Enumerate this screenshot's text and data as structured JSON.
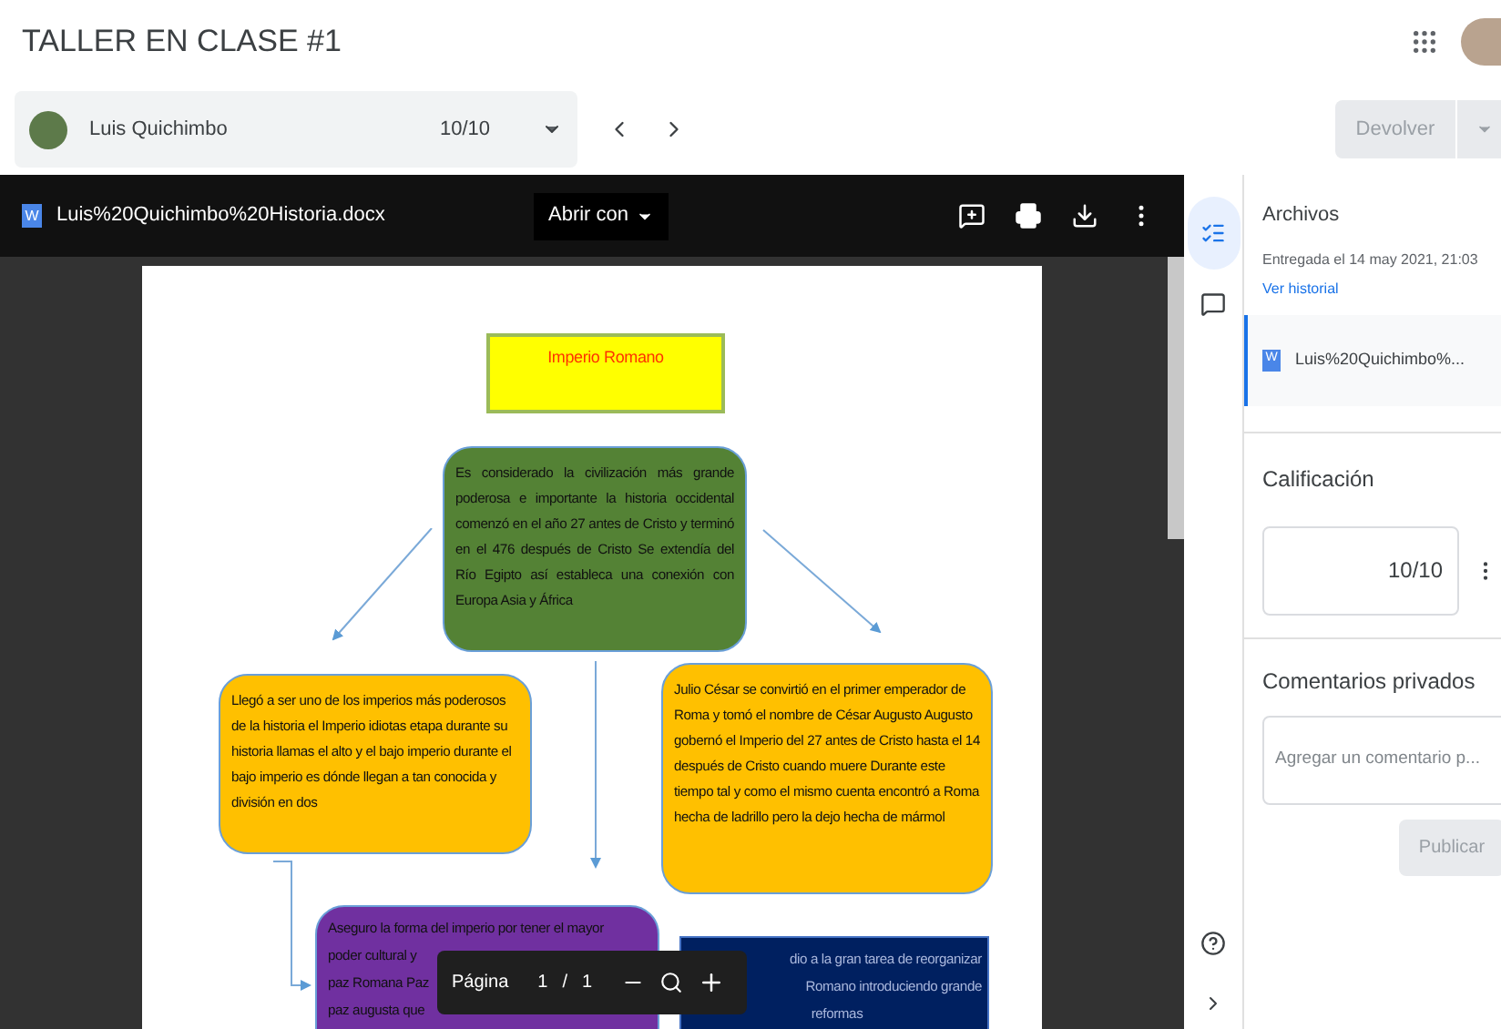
{
  "header": {
    "title": "TALLER EN CLASE #1"
  },
  "student_bar": {
    "name": "Luis Quichimbo",
    "grade": "10/10",
    "return_button": "Devolver"
  },
  "viewer": {
    "file_badge": "W",
    "file_name": "Luis%20Quichimbo%20Historia.docx",
    "open_with": "Abrir con",
    "page_toolbar": {
      "label": "Página",
      "current": "1",
      "separator": "/",
      "total": "1"
    }
  },
  "diagram": {
    "nodes": [
      {
        "kind": "title",
        "text": "Imperio Romano"
      },
      {
        "kind": "green",
        "text": "Es considerado la civilización más grande poderosa e importante la historia occidental comenzó en el año 27 antes de Cristo y terminó en el 476 después de Cristo Se extendía del Río Egipto así estableca una conexión con Europa Asia y África"
      },
      {
        "kind": "orange",
        "text": "Llegó a ser uno de los imperios más poderosos de la historia el Imperio idiotas etapa durante su historia llamas el alto y el bajo imperio durante el bajo imperio es dónde llegan a tan conocida y división en dos"
      },
      {
        "kind": "orange",
        "text": "Julio César se convirtió en el primer emperador de Roma y tomó el nombre de César Augusto Augusto gobernó el Imperio del 27 antes de Cristo hasta el 14 después de Cristo cuando muere Durante este tiempo tal y como el mismo cuenta encontró a Roma hecha de ladrillo pero la dejo hecha de mármol"
      },
      {
        "kind": "purple",
        "lines": [
          {
            "kind": "full",
            "text": "Aseguro la forma del imperio por tener el mayor"
          },
          {
            "kind": "left",
            "text": "poder cultural y"
          },
          {
            "kind": "left",
            "text": "paz Romana Paz"
          },
          {
            "kind": "left",
            "text": "paz augusta que"
          }
        ]
      },
      {
        "kind": "navy",
        "lines": [
          {
            "kind": "right",
            "text": "dio a la gran tarea de reorganizar"
          },
          {
            "kind": "right",
            "text": "Romano introduciendo grande"
          },
          {
            "kind": "center",
            "text": "reformas"
          }
        ]
      }
    ]
  },
  "side_panel": {
    "files_title": "Archivos",
    "submitted": "Entregada el 14 may 2021, 21:03",
    "history_link": "Ver historial",
    "attachment": {
      "badge": "W",
      "name": "Luis%20Quichimbo%..."
    },
    "grade_title": "Calificación",
    "grade_value": "10/10",
    "comments_title": "Comentarios privados",
    "comment_placeholder": "Agregar un comentario p...",
    "post_button": "Publicar"
  }
}
